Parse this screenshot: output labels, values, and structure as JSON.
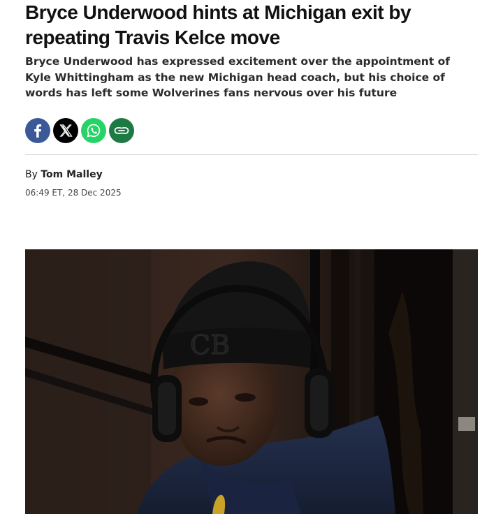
{
  "article": {
    "headline": "Bryce Underwood hints at Michigan exit by repeating Travis Kelce move",
    "standfirst": "Bryce Underwood has expressed excitement over the appointment of Kyle Whittingham as the new Michigan head coach, but his choice of words has left some Wolverines fans nervous over his future",
    "byline_prefix": "By",
    "author": "Tom Malley",
    "timestamp": "06:49 ET, 28 Dec 2025"
  },
  "share": {
    "buttons": [
      {
        "icon": "facebook-icon",
        "color": "#3b5998"
      },
      {
        "icon": "x-icon",
        "color": "#000000"
      },
      {
        "icon": "whatsapp-icon",
        "color": "#25d366"
      },
      {
        "icon": "link-icon",
        "color": "#1e7a45"
      }
    ]
  },
  "hero_image": {
    "beanie_logo": "CB"
  }
}
